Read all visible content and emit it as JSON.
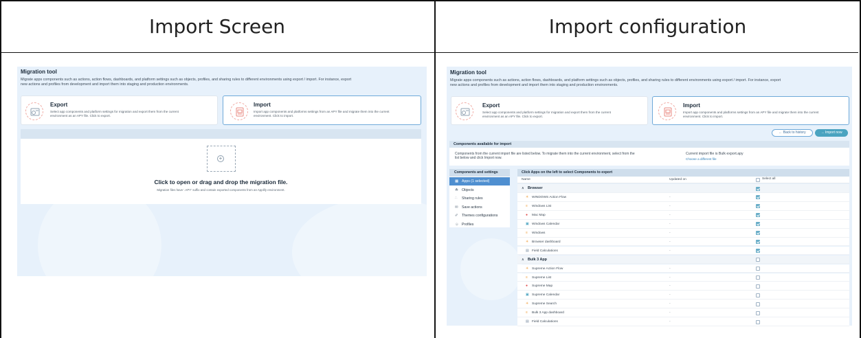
{
  "header": {
    "left_title": "Import Screen",
    "right_title": "Import configuration"
  },
  "migration": {
    "title": "Migration tool",
    "description_line1": "Migrate apps components such as actions, action flows, dashboards, and platform settings such as objects, profiles, and sharing rules to different environments using export / import. For instance, export",
    "description_line2": "new actions and profiles from development and import them into staging and production environments.",
    "export": {
      "title": "Export",
      "desc_line1": "Select app components and platform settings for migration and export them from the current",
      "desc_line2": "environment as an APY file. Click to export."
    },
    "import": {
      "title": "Import",
      "desc_line1": "Import app components and platforms settings from an APY file and migrate them into the current",
      "desc_line2": "environment. Click to import."
    }
  },
  "dropzone": {
    "main_text": "Click to open or drag and drop the migration file.",
    "sub_text": "Migration files have '.APY' suffix and contain exported components from an Applify environment."
  },
  "config": {
    "back_label": "← Back to history",
    "import_now_label": "→ Import now",
    "available_title": "Components available for import",
    "available_desc_line1": "Components from the current import file are listed below. To migrate them into the current environment, select from the",
    "available_desc_line2": "list below and click Import now.",
    "current_file": "Current import file is Bulk export.apy",
    "choose_file": "Choose a different file",
    "side_title": "Components and settings",
    "side_items": [
      {
        "label": "Apps (1 selected)",
        "icon": "grid-icon",
        "glyph": "▦"
      },
      {
        "label": "Objects",
        "icon": "objects-icon",
        "glyph": "☘"
      },
      {
        "label": "Sharing rules",
        "icon": "share-icon",
        "glyph": "∴"
      },
      {
        "label": "Save actions",
        "icon": "save-icon",
        "glyph": "✉"
      },
      {
        "label": "Themes configurations",
        "icon": "brush-icon",
        "glyph": "✐"
      },
      {
        "label": "Profiles",
        "icon": "person-icon",
        "glyph": "☺"
      }
    ],
    "table_title": "Click Apps on the left to select Components to export",
    "col_name": "Name",
    "col_updated": "Updated on",
    "select_all": "Select all",
    "rows": [
      {
        "type": "group",
        "name": "Browser",
        "updated": "",
        "checked": true
      },
      {
        "type": "item",
        "name": "WINDOWS Action Flow",
        "updated": "-",
        "checked": true,
        "glyph": "✳",
        "color": "#f0a040"
      },
      {
        "type": "item",
        "name": "Windows List",
        "updated": "-",
        "checked": true,
        "glyph": "≡",
        "color": "#f0a040"
      },
      {
        "type": "item",
        "name": "Mac Map",
        "updated": "-",
        "checked": true,
        "glyph": "●",
        "color": "#e04a4a"
      },
      {
        "type": "item",
        "name": "Windows Calendar",
        "updated": "-",
        "checked": true,
        "glyph": "▣",
        "color": "#4aa3c0"
      },
      {
        "type": "item",
        "name": "Windows",
        "updated": "-",
        "checked": true,
        "glyph": "≡",
        "color": "#f0a040"
      },
      {
        "type": "item",
        "name": "Browser dashboard",
        "updated": "-",
        "checked": true,
        "glyph": "✳",
        "color": "#f0a040"
      },
      {
        "type": "item",
        "name": "Field Calculations",
        "updated": "-",
        "checked": true,
        "glyph": "▤",
        "color": "#7a8ea2"
      },
      {
        "type": "group",
        "name": "Bulk 3 App",
        "updated": "",
        "checked": false
      },
      {
        "type": "item",
        "name": "Supreme Action Flow",
        "updated": "-",
        "checked": false,
        "glyph": "✳",
        "color": "#f0a040"
      },
      {
        "type": "item",
        "name": "Supreme List",
        "updated": "-",
        "checked": false,
        "glyph": "≡",
        "color": "#f0a040"
      },
      {
        "type": "item",
        "name": "Supreme Map",
        "updated": "-",
        "checked": false,
        "glyph": "●",
        "color": "#e04a4a"
      },
      {
        "type": "item",
        "name": "Supreme Calendar",
        "updated": "-",
        "checked": false,
        "glyph": "▣",
        "color": "#4aa3c0"
      },
      {
        "type": "item",
        "name": "Supreme Search",
        "updated": "-",
        "checked": false,
        "glyph": "✳",
        "color": "#f0a040"
      },
      {
        "type": "item",
        "name": "Bulk 3 App dashboard",
        "updated": "-",
        "checked": false,
        "glyph": "≡",
        "color": "#f0a040"
      },
      {
        "type": "item",
        "name": "Field Calculations",
        "updated": "-",
        "checked": false,
        "glyph": "▤",
        "color": "#7a8ea2"
      }
    ]
  }
}
